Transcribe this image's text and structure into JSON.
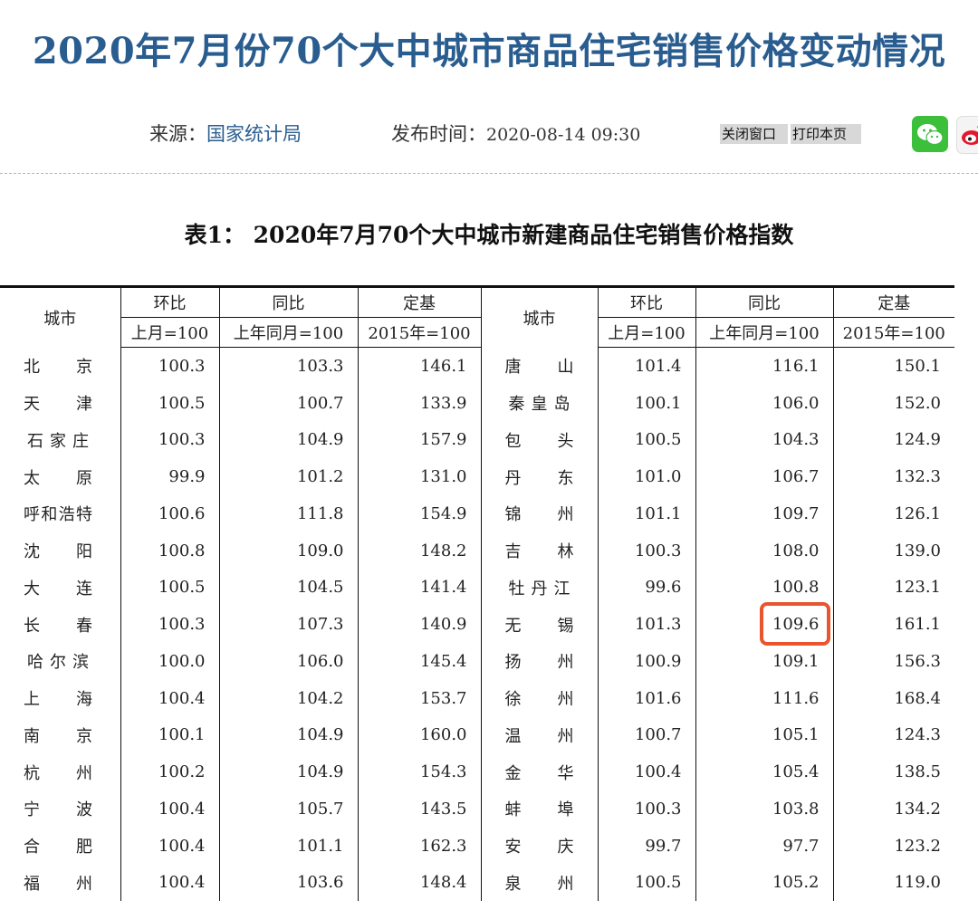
{
  "title": "2020年7月份70个大中城市商品住宅销售价格变动情况",
  "meta": {
    "source_label": "来源：",
    "source_value": "国家统计局",
    "date_label": "发布时间：",
    "date_value": "2020-08-14 09:30"
  },
  "actions": {
    "close_label": "关闭窗口",
    "print_label": "打印本页"
  },
  "share": {
    "wechat_icon": "wechat-icon",
    "weibo_icon": "weibo-icon",
    "wechat_color": "#3cbf3b"
  },
  "table": {
    "caption": "表1： 2020年7月70个大中城市新建商品住宅销售价格指数",
    "headers": {
      "city": "城市",
      "mom": "环比",
      "yoy": "同比",
      "base": "定基",
      "mom_base": "上月=100",
      "yoy_base": "上年同月=100",
      "base_base": "2015年=100"
    },
    "highlight_color": "#e8552e",
    "rows": [
      {
        "left": {
          "city": "北京",
          "mom": "100.3",
          "yoy": "103.3",
          "base": "146.1"
        },
        "right": {
          "city": "唐山",
          "mom": "101.4",
          "yoy": "116.1",
          "base": "150.1"
        }
      },
      {
        "left": {
          "city": "天津",
          "mom": "100.5",
          "yoy": "100.7",
          "base": "133.9"
        },
        "right": {
          "city": "秦皇岛",
          "mom": "100.1",
          "yoy": "106.0",
          "base": "152.0"
        }
      },
      {
        "left": {
          "city": "石家庄",
          "mom": "100.3",
          "yoy": "104.9",
          "base": "157.9"
        },
        "right": {
          "city": "包头",
          "mom": "100.5",
          "yoy": "104.3",
          "base": "124.9"
        }
      },
      {
        "left": {
          "city": "太原",
          "mom": "99.9",
          "yoy": "101.2",
          "base": "131.0"
        },
        "right": {
          "city": "丹东",
          "mom": "101.0",
          "yoy": "106.7",
          "base": "132.3"
        }
      },
      {
        "left": {
          "city": "呼和浩特",
          "mom": "100.6",
          "yoy": "111.8",
          "base": "154.9"
        },
        "right": {
          "city": "锦州",
          "mom": "101.1",
          "yoy": "109.7",
          "base": "126.1"
        }
      },
      {
        "left": {
          "city": "沈阳",
          "mom": "100.8",
          "yoy": "109.0",
          "base": "148.2"
        },
        "right": {
          "city": "吉林",
          "mom": "100.3",
          "yoy": "108.0",
          "base": "139.0"
        }
      },
      {
        "left": {
          "city": "大连",
          "mom": "100.5",
          "yoy": "104.5",
          "base": "141.4"
        },
        "right": {
          "city": "牡丹江",
          "mom": "99.6",
          "yoy": "100.8",
          "base": "123.1"
        }
      },
      {
        "left": {
          "city": "长春",
          "mom": "100.3",
          "yoy": "107.3",
          "base": "140.9"
        },
        "right": {
          "city": "无锡",
          "mom": "101.3",
          "yoy": "109.6",
          "base": "161.1"
        }
      },
      {
        "left": {
          "city": "哈尔滨",
          "mom": "100.0",
          "yoy": "106.0",
          "base": "145.4"
        },
        "right": {
          "city": "扬州",
          "mom": "100.9",
          "yoy": "109.1",
          "base": "156.3"
        }
      },
      {
        "left": {
          "city": "上海",
          "mom": "100.4",
          "yoy": "104.2",
          "base": "153.7"
        },
        "right": {
          "city": "徐州",
          "mom": "101.6",
          "yoy": "111.6",
          "base": "168.4"
        }
      },
      {
        "left": {
          "city": "南京",
          "mom": "100.1",
          "yoy": "104.9",
          "base": "160.0"
        },
        "right": {
          "city": "温州",
          "mom": "100.7",
          "yoy": "105.1",
          "base": "124.3"
        }
      },
      {
        "left": {
          "city": "杭州",
          "mom": "100.2",
          "yoy": "104.9",
          "base": "154.3"
        },
        "right": {
          "city": "金华",
          "mom": "100.4",
          "yoy": "105.4",
          "base": "138.5"
        }
      },
      {
        "left": {
          "city": "宁波",
          "mom": "100.4",
          "yoy": "105.7",
          "base": "143.5"
        },
        "right": {
          "city": "蚌埠",
          "mom": "100.3",
          "yoy": "103.8",
          "base": "134.2"
        }
      },
      {
        "left": {
          "city": "合肥",
          "mom": "100.4",
          "yoy": "101.1",
          "base": "162.3"
        },
        "right": {
          "city": "安庆",
          "mom": "99.7",
          "yoy": "97.7",
          "base": "123.2"
        }
      },
      {
        "left": {
          "city": "福州",
          "mom": "100.4",
          "yoy": "103.6",
          "base": "148.4"
        },
        "right": {
          "city": "泉州",
          "mom": "100.5",
          "yoy": "105.2",
          "base": "119.0"
        }
      }
    ]
  }
}
